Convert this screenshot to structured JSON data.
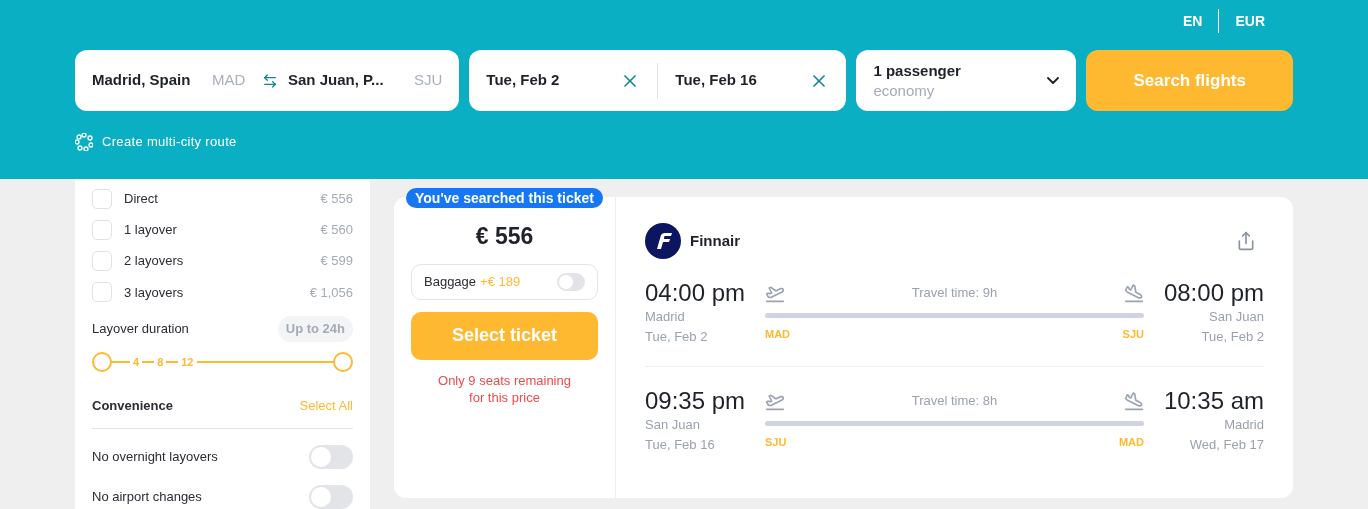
{
  "header": {
    "language": "EN",
    "currency": "EUR"
  },
  "search": {
    "origin": {
      "city": "Madrid, Spain",
      "code": "MAD"
    },
    "destination": {
      "city": "San Juan, P...",
      "code": "SJU"
    },
    "depart": "Tue, Feb 2",
    "return": "Tue, Feb 16",
    "passengers": "1 passenger",
    "cabin": "economy",
    "button": "Search flights"
  },
  "multi_city": "Create multi-city route",
  "filters": {
    "stops": [
      {
        "label": "Direct",
        "price": "€ 556",
        "checked": false
      },
      {
        "label": "1 layover",
        "price": "€ 560",
        "checked": false
      },
      {
        "label": "2 layovers",
        "price": "€ 599",
        "checked": false
      },
      {
        "label": "3 layovers",
        "price": "€ 1,056",
        "checked": false
      }
    ],
    "layover_duration": {
      "title": "Layover duration",
      "badge": "Up to 24h",
      "ticks": [
        "4",
        "8",
        "12"
      ],
      "handles": [
        {
          "level": 0
        },
        {
          "level": 1
        }
      ]
    },
    "convenience": {
      "title": "Convenience",
      "select_all": "Select All",
      "options": [
        {
          "label": "No overnight layovers",
          "on": false
        },
        {
          "label": "No airport changes",
          "on": false
        }
      ]
    }
  },
  "ticket": {
    "badge": "You've searched this ticket",
    "price": "€ 556",
    "baggage": {
      "label": "Baggage",
      "price": "+€ 189",
      "on": false
    },
    "button": "Select ticket",
    "warning": [
      "Only 9 seats remaining",
      "for this price"
    ],
    "airline": "Finnair",
    "legs": [
      {
        "dep_time": "04:00 pm",
        "dep_city": "Madrid",
        "dep_date": "Tue, Feb 2",
        "duration": "Travel time: 9h",
        "from": "MAD",
        "to": "SJU",
        "arr_time": "08:00 pm",
        "arr_city": "San Juan",
        "arr_date": "Tue, Feb 2"
      },
      {
        "dep_time": "09:35 pm",
        "dep_city": "San Juan",
        "dep_date": "Tue, Feb 16",
        "duration": "Travel time: 8h",
        "from": "SJU",
        "to": "MAD",
        "arr_time": "10:35 am",
        "arr_city": "Madrid",
        "arr_date": "Wed, Feb 17"
      }
    ]
  }
}
